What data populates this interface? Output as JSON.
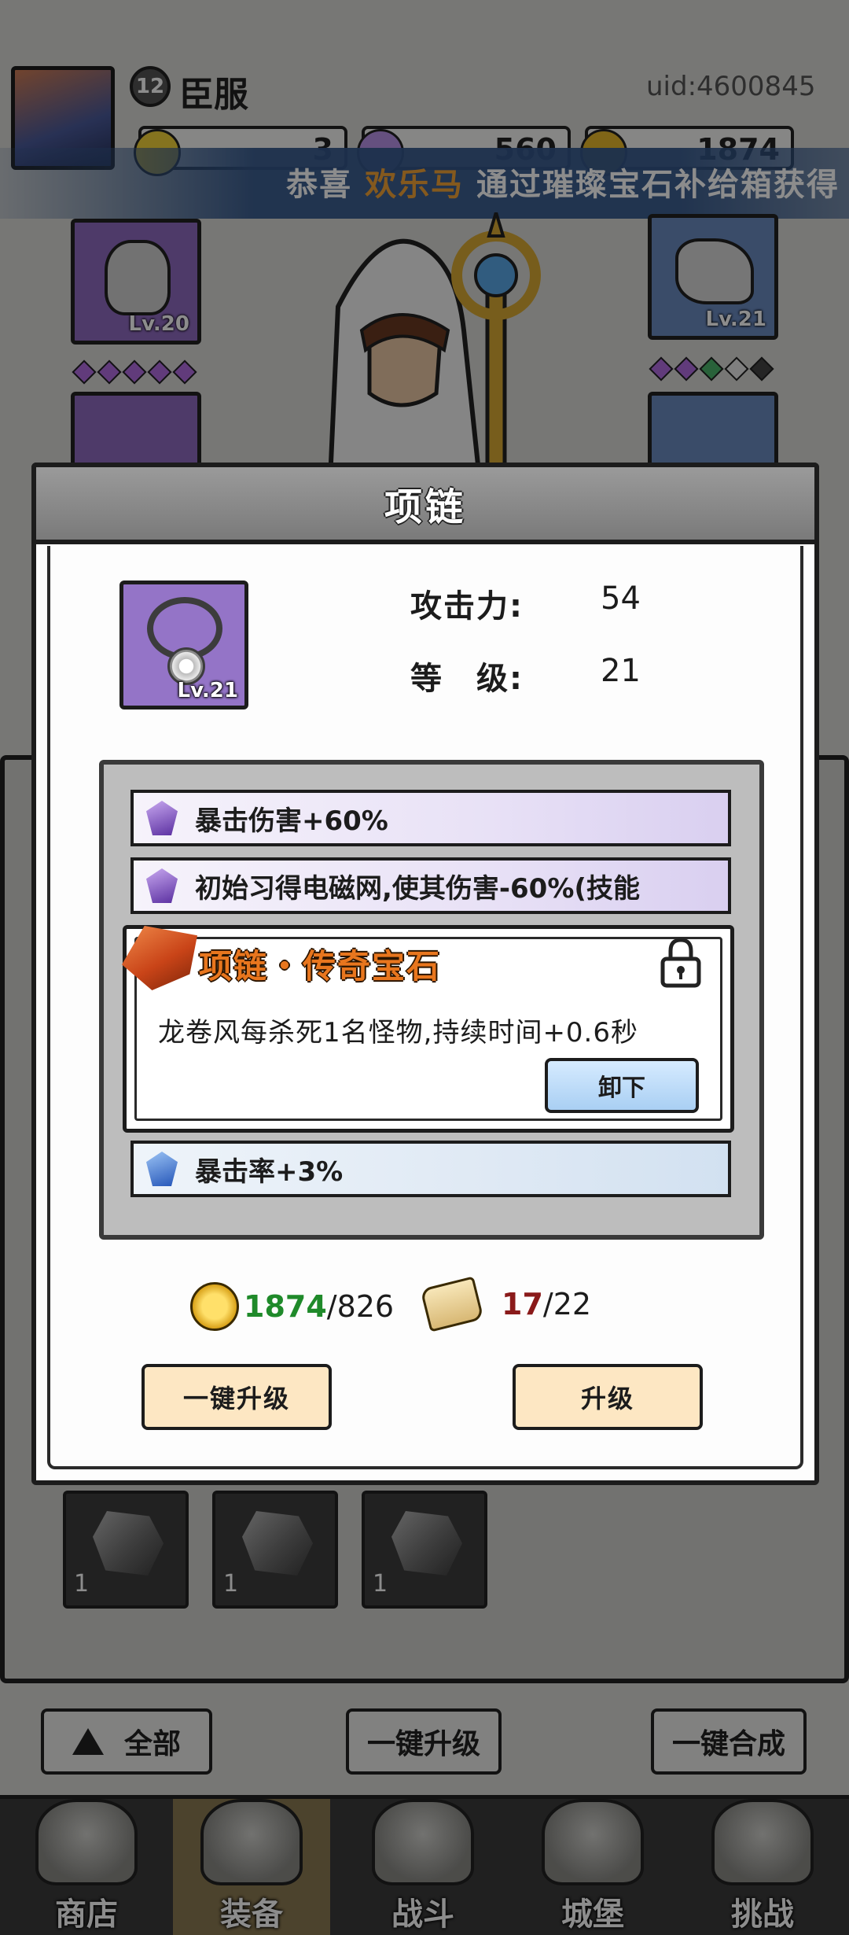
{
  "player": {
    "level": "12",
    "name": "臣服",
    "uid": "uid:4600845"
  },
  "resources": {
    "gem_yellow": "3",
    "gem_purple": "560",
    "coins": "1874"
  },
  "ticker": {
    "prefix": "恭喜",
    "highlight_name": "欢乐马",
    "suffix": "通过璀璨宝石补给箱获得"
  },
  "equip_slots": {
    "helmet_level": "Lv.20",
    "gloves_level": "Lv.21"
  },
  "modal": {
    "title": "项链",
    "item_level": "Lv.21",
    "stats": [
      {
        "label": "攻击力:",
        "value": "54"
      },
      {
        "label": "等　级:",
        "value": "21"
      }
    ],
    "attributes": [
      {
        "text": "暴击伤害+60%",
        "gem": "purple"
      },
      {
        "text": "初始习得电磁网,使其伤害-60%(技能",
        "gem": "purple"
      },
      {
        "text": "暴击率+3%",
        "gem": "blue"
      }
    ],
    "gem_popup": {
      "title": "项链・传奇宝石",
      "description": "龙卷风每杀死1名怪物,持续时间+0.6秒",
      "unequip_label": "卸下"
    },
    "costs": {
      "coins_have": "1874",
      "coins_need": "/826",
      "scrolls_have": "17",
      "scrolls_need": "/22"
    },
    "buttons": {
      "one_click_upgrade": "一键升级",
      "upgrade": "升级"
    }
  },
  "inventory": {
    "items": [
      {
        "count": "1"
      },
      {
        "count": "1"
      },
      {
        "count": "1"
      }
    ]
  },
  "bottom_buttons": {
    "all": "全部",
    "one_click_upgrade": "一键升级",
    "one_click_merge": "一键合成"
  },
  "nav": [
    {
      "label": "商店"
    },
    {
      "label": "装备"
    },
    {
      "label": "战斗"
    },
    {
      "label": "城堡"
    },
    {
      "label": "挑战"
    }
  ],
  "colors": {
    "slot_purple": "#8f6bc0",
    "slot_blue": "#6a8ac0",
    "legend_orange": "#e8761e",
    "button_cream": "#fde7c3",
    "unequip_blue": "#a9cff3"
  }
}
